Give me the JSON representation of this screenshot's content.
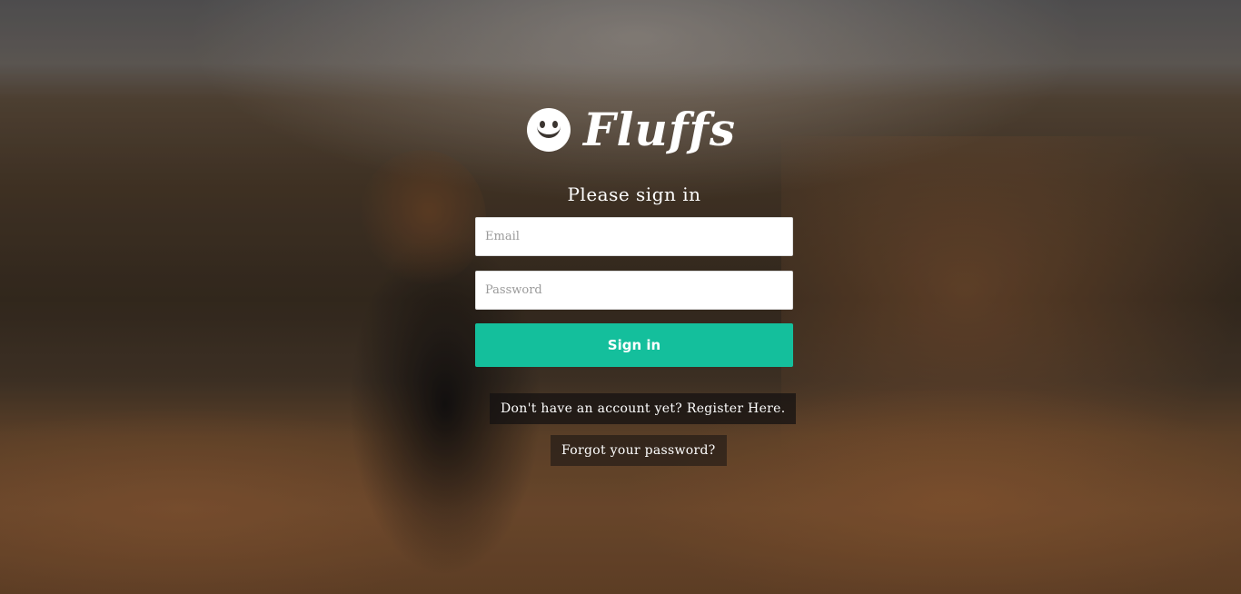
{
  "brand": {
    "name": "Fluffs",
    "logo_icon": "smiley-face-icon"
  },
  "form": {
    "heading": "Please sign in",
    "email_placeholder": "Email",
    "email_value": "",
    "password_placeholder": "Password",
    "password_value": "",
    "submit_label": "Sign in"
  },
  "links": {
    "register": "Don't have an account yet? Register Here.",
    "forgot_password": "Forgot your password?"
  },
  "colors": {
    "primary_button": "#14bf9c",
    "text": "#ffffff"
  }
}
